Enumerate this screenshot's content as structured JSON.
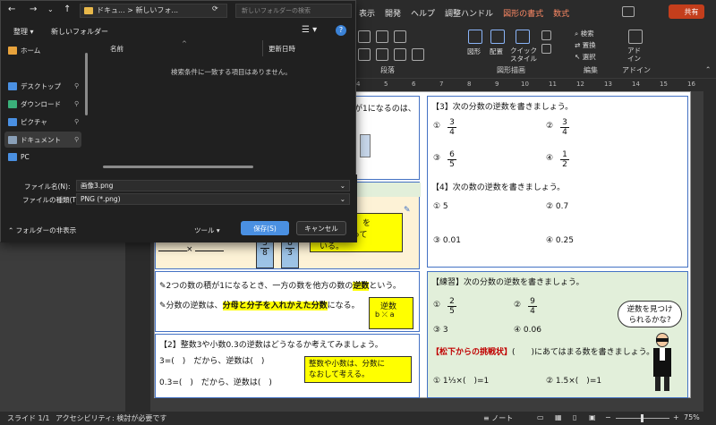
{
  "ribbon": {
    "tabs": [
      "表示",
      "開発",
      "ヘルプ",
      "調整ハンドル",
      "図形の書式",
      "数式"
    ],
    "share_label": "共有",
    "groups": {
      "paragraph": "段落",
      "drawing": "図形描画",
      "editing": "編集",
      "addins": "アドイン"
    },
    "shape_label": "図形",
    "arrange_label": "配置",
    "quick_style_label": "クイック\nスタイル",
    "search_label": "検索",
    "replace_label": "置換",
    "select_label": "選択",
    "addin_label": "アド\nイン"
  },
  "ruler": {
    "marks": [
      "4",
      "5",
      "6",
      "7",
      "8",
      "9",
      "10",
      "11",
      "12",
      "13",
      "14",
      "15",
      "16"
    ]
  },
  "dialog": {
    "breadcrumb_1": "ドキュ...",
    "breadcrumb_2": "新しいフォ...",
    "search_placeholder": "新しいフォルダーの検索",
    "organize_label": "整理",
    "new_folder_label": "新しいフォルダー",
    "col_name": "名前",
    "col_date": "更新日時",
    "empty_message": "検索条件に一致する項目はありません。",
    "nav": [
      {
        "label": "ホーム",
        "color": "#e8a33c"
      },
      {
        "label": "デスクトップ",
        "color": "#4a90e2"
      },
      {
        "label": "ダウンロード",
        "color": "#3ab07a"
      },
      {
        "label": "ピクチャ",
        "color": "#4a90e2"
      },
      {
        "label": "ドキュメント",
        "color": "#8aa0b8"
      },
      {
        "label": "PC",
        "color": "#4a90e2"
      }
    ],
    "filename_label": "ファイル名(N):",
    "filename_value": "画像3.png",
    "filetype_label": "ファイルの種類(T):",
    "filetype_value": "PNG (*.png)",
    "hide_folders_label": "フォルダーの非表示",
    "tools_label": "ツール",
    "save_label": "保存(S)",
    "cancel_label": "キャンセル"
  },
  "slide": {
    "left_top_text": "が1になるのは、",
    "hint_text": "【　　】を",
    "hint_text2": "た数になって",
    "hint_text3": "いる。",
    "frac_3_8": [
      "3",
      "8"
    ],
    "frac_8_3": [
      "8",
      "3"
    ],
    "frac_times": "×",
    "def_1_pre": "2つの数の積が1になるとき、一方の数を他方の数の",
    "def_1_hl": "逆数",
    "def_1_post": "という。",
    "def_2_pre": "分数の逆数は、",
    "def_2_hl": "分母と分子を入れかえた分数",
    "def_2_post": "になる。",
    "gyakusu_label": "逆数",
    "q2_title": "【2】整数3や小数0.3の逆数はどうなるか考えてみましょう。",
    "q2_line1_a": "3=",
    "q2_line1_b": "だから、逆数は",
    "q2_line2_a": "0.3=",
    "q2_line2_b": "だから、逆数は",
    "q2_note": "整数や小数は、分数に\nなおして考える。",
    "q3_title": "【3】次の分数の逆数を書きましょう。",
    "q3_items": [
      {
        "num": "①",
        "n": "3",
        "d": "4"
      },
      {
        "num": "②",
        "n": "3",
        "d": "4"
      },
      {
        "num": "③",
        "n": "6",
        "d": "5"
      },
      {
        "num": "④",
        "n": "1",
        "d": "2"
      }
    ],
    "q4_title": "【4】次の数の逆数を書きましょう。",
    "q4_items": [
      "①  5",
      "②  0.7",
      "③  0.01",
      "④  0.25"
    ],
    "practice_title": "【練習】次の分数の逆数を書きましょう。",
    "practice_items": [
      {
        "num": "①",
        "n": "2",
        "d": "5"
      },
      {
        "num": "②",
        "n": "9",
        "d": "4"
      }
    ],
    "practice_3": "③  3",
    "practice_4": "④  0.06",
    "bubble": "逆数を見つけ\nられるかな?",
    "challenge_title": "【松下からの挑戦状】",
    "challenge_text": "(　　)にあてはまる数を書きましょう。",
    "ch_1_pre": "①  1",
    "ch_1_mid": "×",
    "ch_1_post": "=1",
    "ch_2_pre": "②  1.5×",
    "ch_2_post": "=1"
  },
  "status": {
    "slide_info": "スライド 1/1",
    "accessibility": "アクセシビリティ: 検討が必要です",
    "notes_label": "ノート",
    "zoom": "75%"
  }
}
